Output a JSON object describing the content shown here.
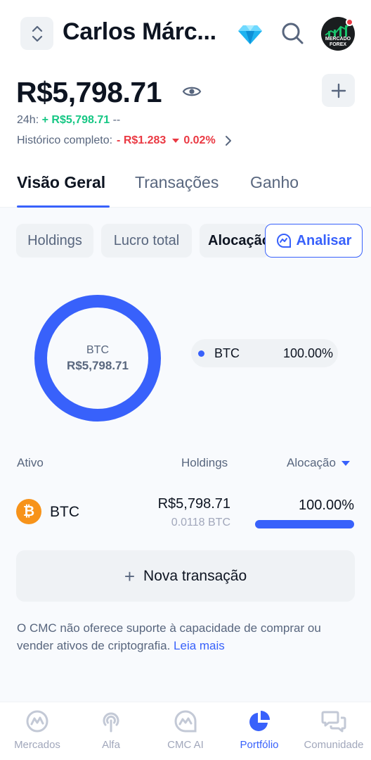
{
  "header": {
    "title": "Carlos Márc...",
    "switcher_icon": "chevron-up-down-icon",
    "premium_icon": "diamond-icon",
    "search_icon": "search-icon",
    "avatar_text_line1": "MERCADO",
    "avatar_text_line2": "FOREX"
  },
  "balance": {
    "amount": "R$5,798.71",
    "change_24h_label": "24h:",
    "change_24h_value": "+ R$5,798.71",
    "change_24h_pct": "--",
    "history_label": "Histórico completo:",
    "history_value": "- R$1.283",
    "history_pct": "0.02%"
  },
  "tabs": [
    {
      "label": "Visão Geral",
      "active": true
    },
    {
      "label": "Transações",
      "active": false
    },
    {
      "label": "Ganho",
      "active": false
    }
  ],
  "chips": {
    "holdings": "Holdings",
    "lucro": "Lucro total",
    "alocacao": "Alocação",
    "analisar": "Analisar"
  },
  "allocation": {
    "center_asset": "BTC",
    "center_value": "R$5,798.71",
    "legend": [
      {
        "name": "BTC",
        "pct": "100.00%",
        "color": "#3861fb"
      }
    ]
  },
  "table": {
    "headers": {
      "asset": "Ativo",
      "holdings": "Holdings",
      "allocation": "Alocação"
    },
    "rows": [
      {
        "name": "BTC",
        "value": "R$5,798.71",
        "amount": "0.0118 BTC",
        "pct": "100.00%",
        "fraction": 1.0
      }
    ]
  },
  "actions": {
    "new_transaction": "Nova transação"
  },
  "disclaimer": {
    "text": "O CMC não oferece suporte à capacidade de comprar ou vender ativos de criptografia.",
    "link": "Leia mais"
  },
  "nav": [
    {
      "label": "Mercados",
      "icon": "cmc-logo-icon",
      "active": false
    },
    {
      "label": "Alfa",
      "icon": "broadcast-icon",
      "active": false
    },
    {
      "label": "CMC AI",
      "icon": "cmc-ai-icon",
      "active": false
    },
    {
      "label": "Portfólio",
      "icon": "pie-chart-icon",
      "active": true
    },
    {
      "label": "Comunidade",
      "icon": "chat-bubbles-icon",
      "active": false
    }
  ],
  "colors": {
    "accent": "#3861fb",
    "positive": "#16c784",
    "negative": "#ea3943",
    "btc": "#f7931a"
  }
}
